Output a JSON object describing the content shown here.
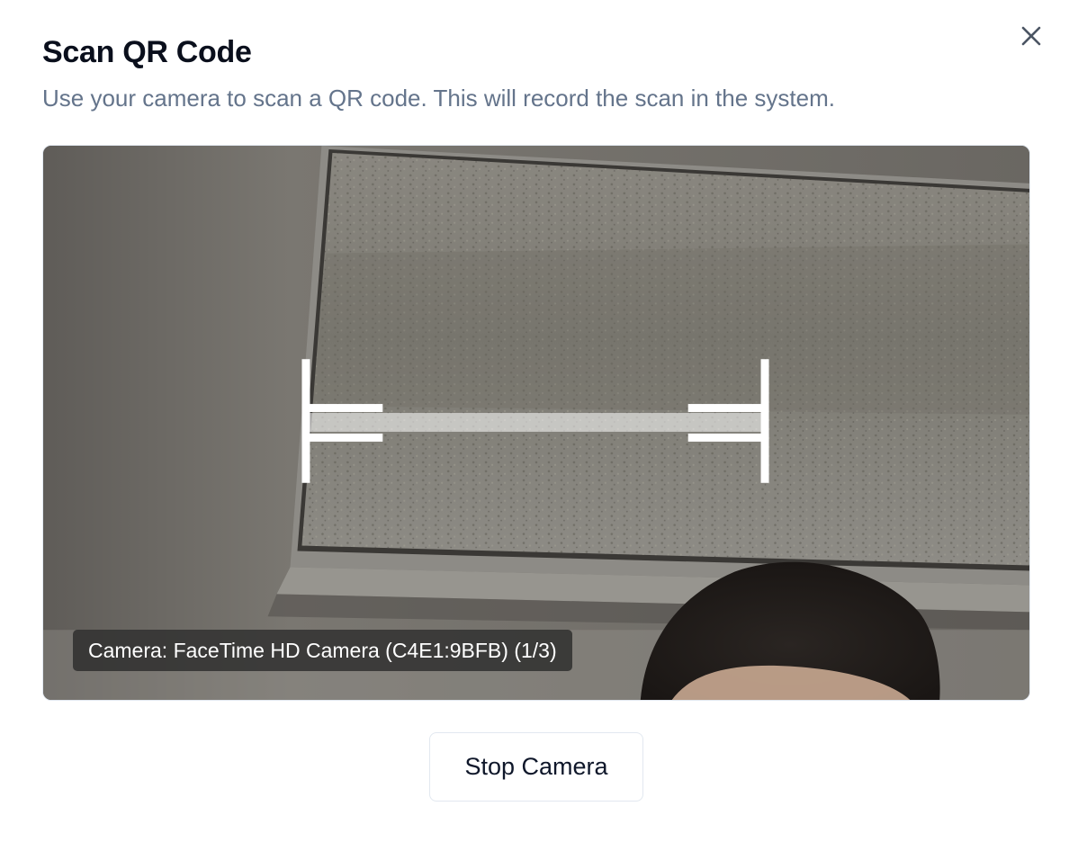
{
  "dialog": {
    "title": "Scan QR Code",
    "description": "Use your camera to scan a QR code. This will record the scan in the system.",
    "close_icon": "close-icon"
  },
  "camera": {
    "label": "Camera: FaceTime HD Camera (C4E1:9BFB) (1/3)",
    "scan_region_icon": "scan-region-frame"
  },
  "actions": {
    "stop_label": "Stop Camera"
  },
  "colors": {
    "title": "#0a0f1c",
    "description": "#64748b",
    "border": "#e2e8f0",
    "overlay_bg": "#282828"
  }
}
